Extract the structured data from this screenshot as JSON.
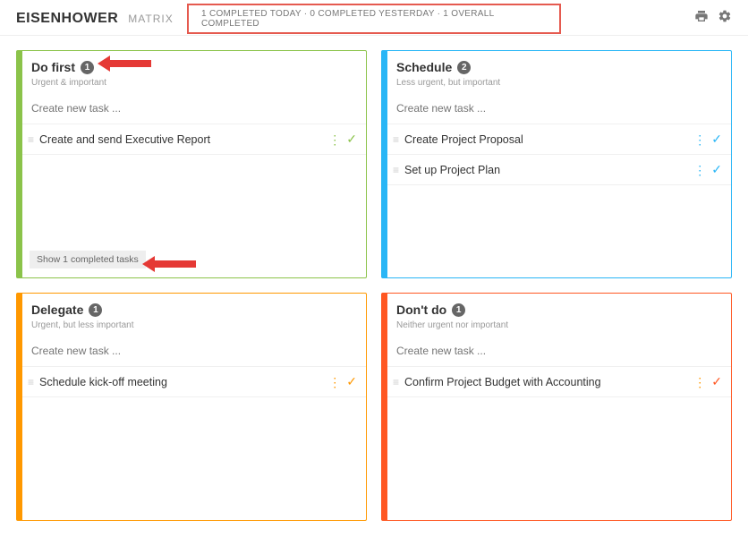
{
  "header": {
    "brand_strong": "EISENHOWER",
    "brand_thin": "MATRIX",
    "stats": "1 COMPLETED TODAY · 0 COMPLETED YESTERDAY · 1 OVERALL COMPLETED"
  },
  "quadrants": {
    "do_first": {
      "title": "Do first",
      "count": "1",
      "subtitle": "Urgent & important",
      "placeholder": "Create new task ...",
      "show_completed": "Show 1 completed tasks",
      "tasks": [
        {
          "text": "Create and send Executive Report"
        }
      ]
    },
    "schedule": {
      "title": "Schedule",
      "count": "2",
      "subtitle": "Less urgent, but important",
      "placeholder": "Create new task ...",
      "tasks": [
        {
          "text": "Create Project Proposal"
        },
        {
          "text": "Set up Project Plan"
        }
      ]
    },
    "delegate": {
      "title": "Delegate",
      "count": "1",
      "subtitle": "Urgent, but less important",
      "placeholder": "Create new task ...",
      "tasks": [
        {
          "text": "Schedule kick-off meeting"
        }
      ]
    },
    "dont_do": {
      "title": "Don't do",
      "count": "1",
      "subtitle": "Neither urgent nor important",
      "placeholder": "Create new task ...",
      "tasks": [
        {
          "text": "Confirm Project Budget with Accounting"
        }
      ]
    }
  }
}
